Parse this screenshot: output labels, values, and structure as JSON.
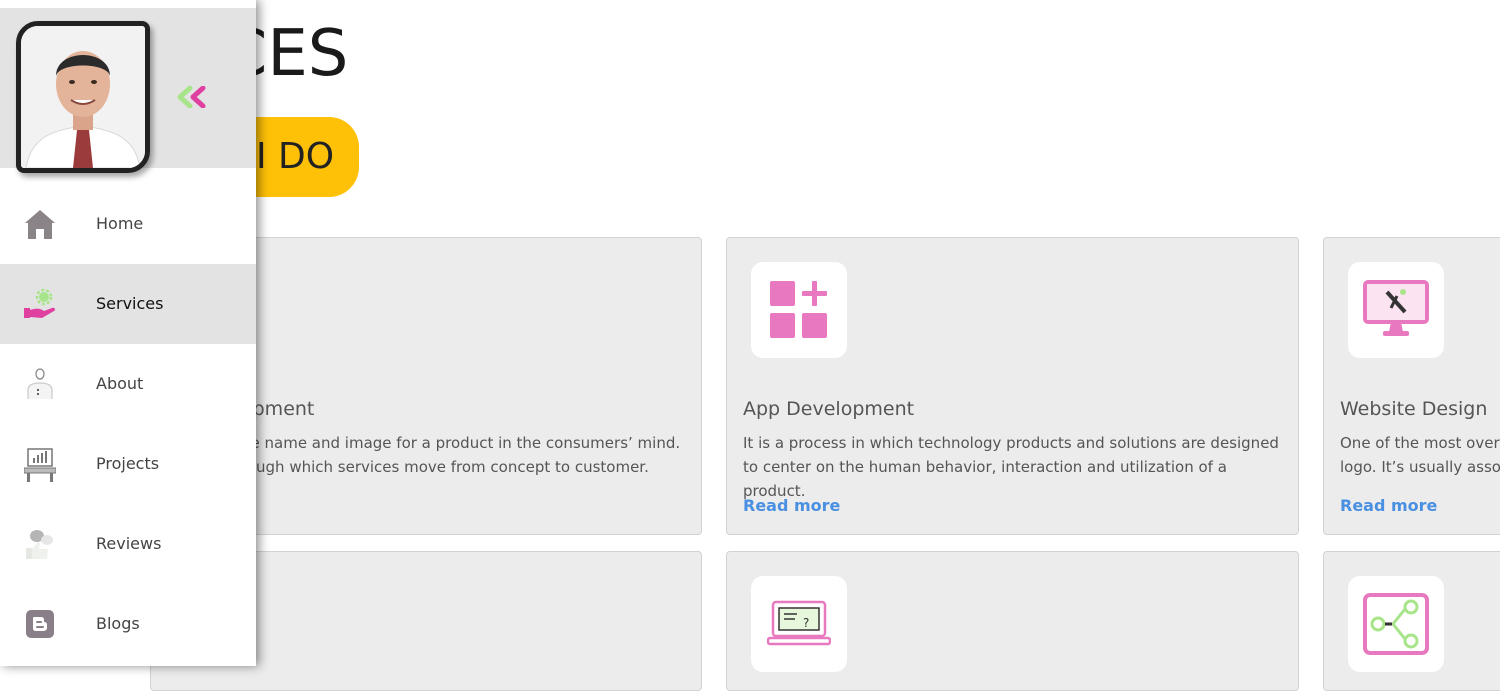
{
  "page": {
    "title": "VICES",
    "pill_text": "I DO"
  },
  "cards": [
    {
      "title": "opment",
      "desc": "ue name and image for a product in the consumers’ mind. rough which services move from concept to customer."
    },
    {
      "title": "App Development",
      "desc": "It is a process in which technology products and solutions are designed to center on the human behavior, interaction and utilization of a product.",
      "read_more": "Read more",
      "icon": "app-grid-plus-icon"
    },
    {
      "title": "Website Design",
      "desc": "One of the most overs logo. It’s usually assoc",
      "read_more": "Read more",
      "icon": "monitor-design-icon"
    },
    {
      "icon": "laptop-question-icon"
    },
    {
      "icon": "share-nodes-icon"
    }
  ],
  "sidebar": {
    "collapse_icon": "double-chevron-left-icon",
    "items": [
      {
        "label": "Home",
        "icon": "home-icon"
      },
      {
        "label": "Services",
        "icon": "services-hand-gear-icon",
        "active": true
      },
      {
        "label": "About",
        "icon": "person-icon"
      },
      {
        "label": "Projects",
        "icon": "desk-computer-icon"
      },
      {
        "label": "Reviews",
        "icon": "reviews-chat-icon"
      },
      {
        "label": "Blogs",
        "icon": "blogger-icon"
      }
    ]
  },
  "colors": {
    "accent_yellow": "#ffc107",
    "pink": "#e879c0",
    "green": "#a8e58a",
    "link_blue": "#4a90e2",
    "card_bg": "#ececec"
  }
}
